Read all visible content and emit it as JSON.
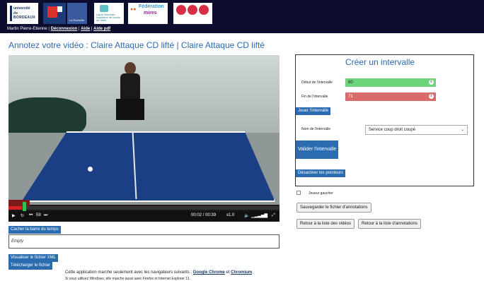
{
  "header": {
    "logos": {
      "univ_bordeaux_line1": "université",
      "univ_bordeaux_line2": "de BORDEAUX",
      "la_rochelle": "La Rochelle",
      "nouvelle_aquitaine": "Ligue Nouvelle-Aquitaine de tennis de table",
      "federation_line1": "Fédération",
      "federation_line2": "mires"
    },
    "user_name": "Martin Pierre-Etienne",
    "links": [
      "Déconnexion",
      "Aide",
      "Aide pdf"
    ],
    "separator": " | "
  },
  "page_title": "Annotez votre vidéo : Claire Attaque CD lifté | Claire Attaque CD lifté",
  "player": {
    "time_current": "00:02",
    "time_separator": " / ",
    "time_total": "00:39",
    "speed": "x1.0",
    "skip_label": "59",
    "progress_fraction": 0.05
  },
  "left_buttons": {
    "hide_timeline": "Cacher la barre du temps",
    "empty_text": "Empty",
    "view_xml": "Visualiser le fichier XML",
    "download": "Télécharger le fichier"
  },
  "footer": {
    "line1_prefix": "Cette application marche seulement avec les navigateurs suivants : ",
    "browser1": "Google Chrome",
    "and": " et ",
    "browser2": "Chromium",
    "line1_suffix": ".",
    "line2": "Si vous utilisez Windows, elle marche aussi avec Firefox et Internet Explorer 11."
  },
  "interval_panel": {
    "title": "Créer un intervalle",
    "start_label": "Début de l'intervalle",
    "start_value": "60",
    "end_label": "Fin de l'intervalle",
    "end_value": "71",
    "play_button": "Jouer l'intervalle",
    "name_label": "Nom de l'intervalle",
    "name_selected": "Service coup droit coupé",
    "validate_button": "Valider l'intervalle",
    "disable_pointers": "Désactiver les pointeurs"
  },
  "right_controls": {
    "left_handed_label": "Joueur gaucher",
    "save_button": "Sauvegarder le fichier d'annotations",
    "back_videos": "Retour à la liste des vidéos",
    "back_annotations": "Retour à la liste d'annotations"
  },
  "colors": {
    "header_bg": "#0c0c2e",
    "title_blue": "#2d6aad",
    "button_blue": "#2b6cb0",
    "start_green": "#6dd47a",
    "end_red": "#d96b6b"
  }
}
